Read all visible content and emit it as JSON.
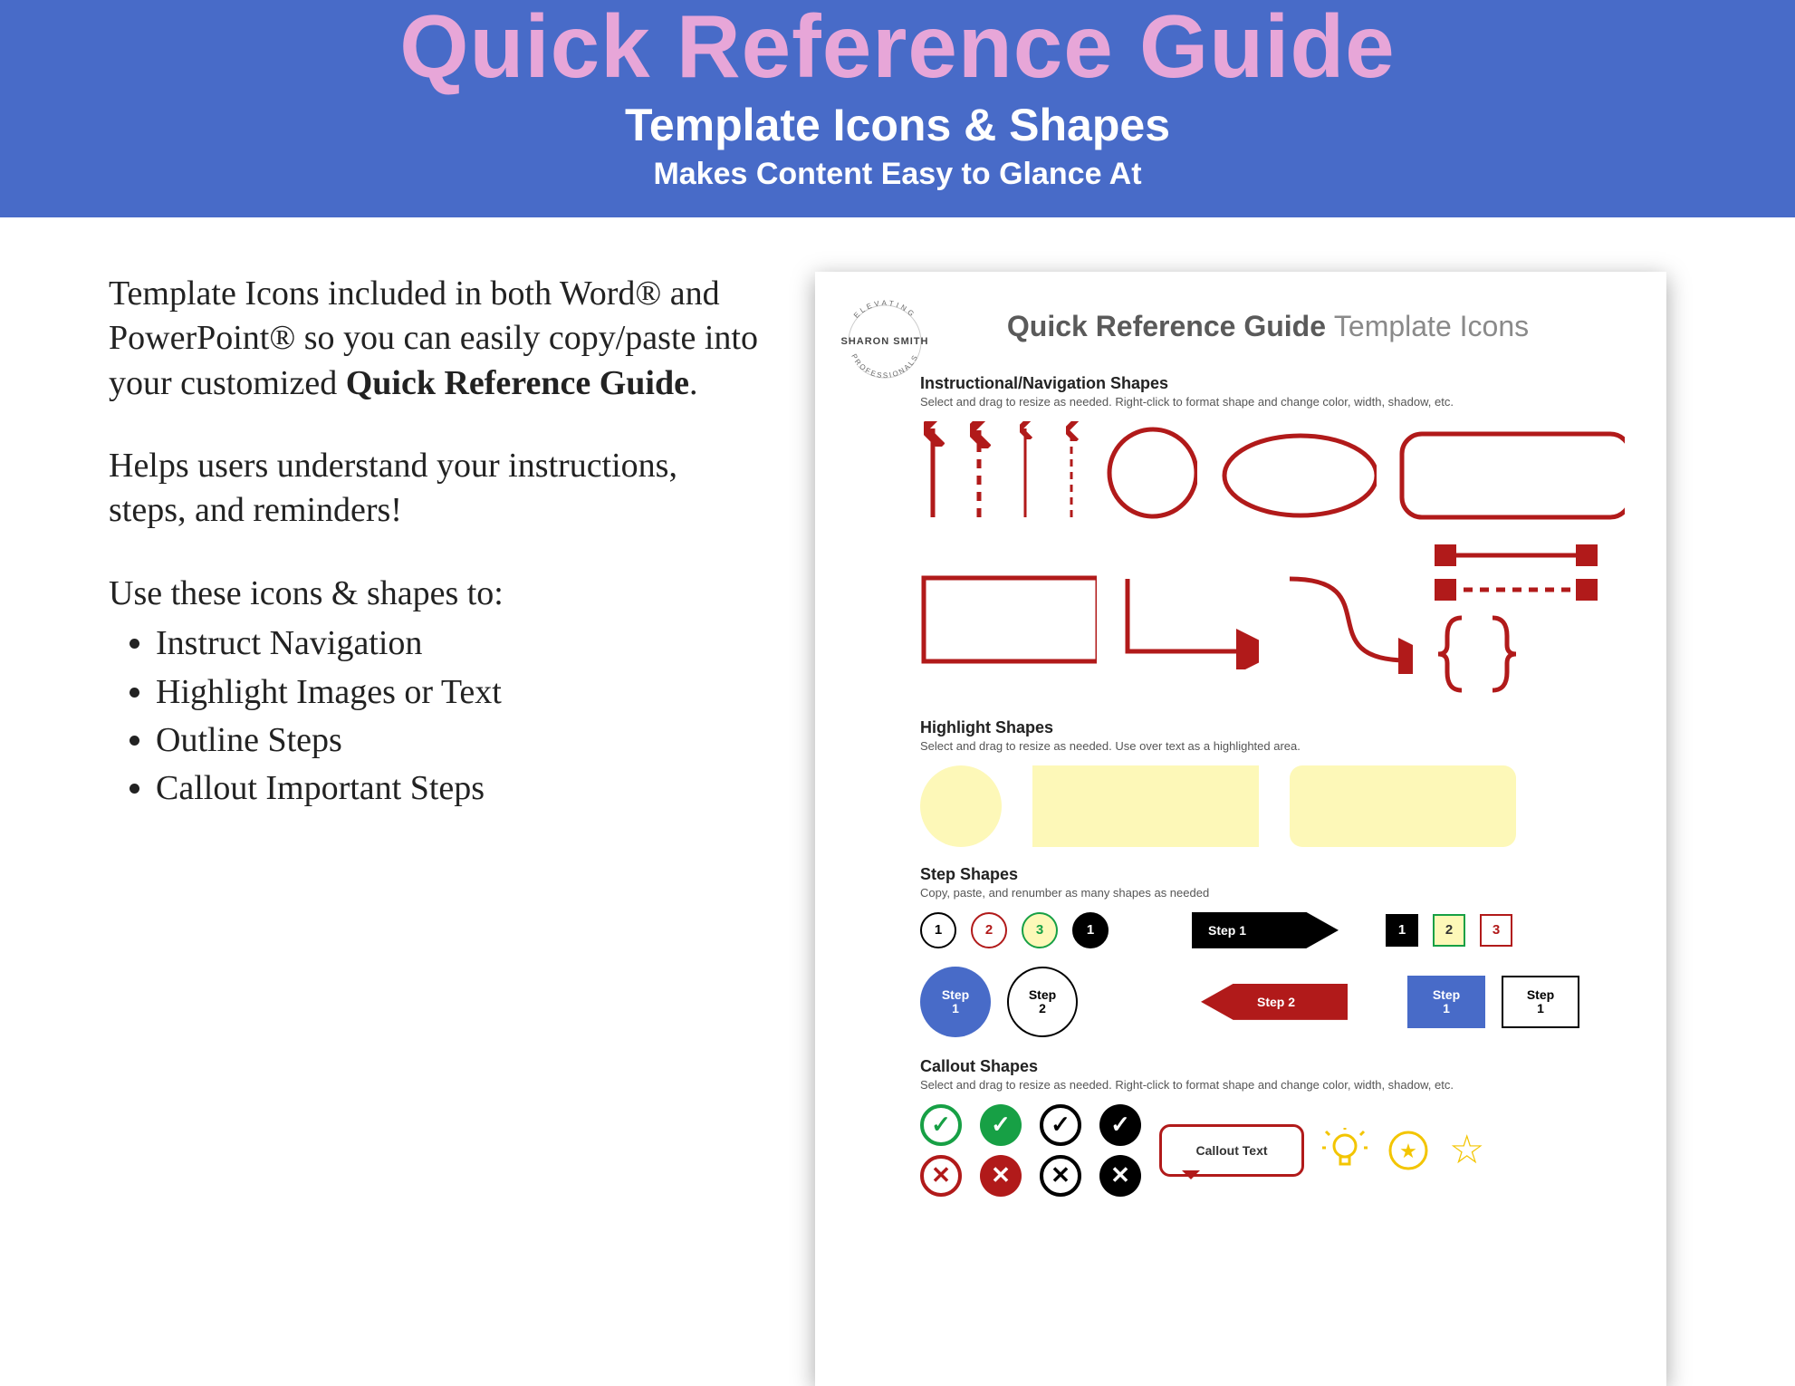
{
  "header": {
    "title": "Quick Reference Guide",
    "subtitle": "Template Icons & Shapes",
    "tagline": "Makes Content Easy to Glance At"
  },
  "left": {
    "para1_pre": "Template Icons included in both Word® and PowerPoint® so you can easily copy/paste into your customized ",
    "para1_bold": "Quick Reference Guide",
    "para1_post": ".",
    "para2": "Helps users understand your instructions, steps, and reminders!",
    "list_intro": "Use these icons & shapes to:",
    "items": [
      "Instruct Navigation",
      "Highlight Images or Text",
      "Outline Steps",
      "Callout Important Steps"
    ]
  },
  "sheet": {
    "logo_name": "SHARON SMITH",
    "logo_top": "ELEVATING",
    "logo_bot": "PROFESSIONALS",
    "title_bold": "Quick Reference Guide",
    "title_light": "Template Icons",
    "sec1_h": "Instructional/Navigation Shapes",
    "sec1_d": "Select and drag to resize as needed. Right-click to format shape and change color, width, shadow, etc.",
    "sec2_h": "Highlight Shapes",
    "sec2_d": "Select and drag to resize as needed. Use over text as a highlighted area.",
    "sec3_h": "Step Shapes",
    "sec3_d": "Copy, paste, and renumber as many shapes as needed",
    "sec4_h": "Callout Shapes",
    "sec4_d": "Select and drag to resize as needed. Right-click to format shape and change color, width, shadow, etc.",
    "steps": {
      "c1": "1",
      "c2": "2",
      "c3": "3",
      "c4": "1",
      "arrow1": "Step 1",
      "sq1": "1",
      "sq2": "2",
      "sq3": "3",
      "big1a": "Step",
      "big1b": "1",
      "big2a": "Step",
      "big2b": "2",
      "arrow2": "Step 2",
      "box1a": "Step",
      "box1b": "1",
      "box2a": "Step",
      "box2b": "1"
    },
    "callout_text": "Callout Text"
  },
  "colors": {
    "red": "#b11a1a",
    "blue": "#486bc8",
    "green": "#17a045",
    "yellow": "#f3c500",
    "pink": "#e7a6d8",
    "hl": "#fdf8b8"
  }
}
